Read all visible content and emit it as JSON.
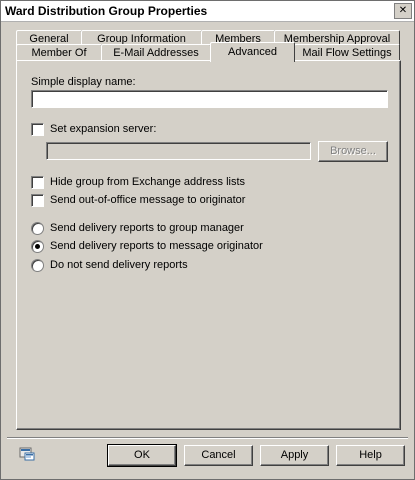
{
  "window": {
    "title": "Ward Distribution Group Properties",
    "close_glyph": "✕"
  },
  "tabs": {
    "row1": [
      "General",
      "Group Information",
      "Members",
      "Membership Approval"
    ],
    "row2": [
      "Member Of",
      "E-Mail Addresses",
      "Advanced",
      "Mail Flow Settings"
    ],
    "active": "Advanced"
  },
  "advanced": {
    "simple_display_name_label": "Simple display name:",
    "simple_display_name_value": "",
    "set_expansion_server_label": "Set expansion server:",
    "set_expansion_server_checked": false,
    "expansion_server_value": "",
    "browse_label": "Browse...",
    "hide_from_gal_label": "Hide group from Exchange address lists",
    "hide_from_gal_checked": false,
    "send_oof_label": "Send out-of-office message to originator",
    "send_oof_checked": false,
    "delivery_reports": {
      "options": [
        "Send delivery reports to group manager",
        "Send delivery reports to message originator",
        "Do not send delivery reports"
      ],
      "selected": "Send delivery reports to message originator"
    }
  },
  "buttons": {
    "ok": "OK",
    "cancel": "Cancel",
    "apply": "Apply",
    "help": "Help"
  },
  "icons": {
    "close": "close-icon",
    "checkbox-unchecked": "checkbox-icon",
    "help": "help-icon"
  }
}
